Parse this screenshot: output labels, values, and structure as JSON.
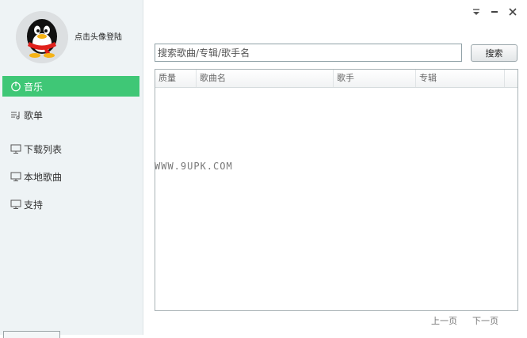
{
  "user": {
    "login_prompt": "点击头像登陆"
  },
  "sidebar": {
    "items": [
      {
        "label": "音乐",
        "icon": "power-icon",
        "active": true
      },
      {
        "label": "歌单",
        "icon": "playlist-icon",
        "active": false
      },
      {
        "label": "下载列表",
        "icon": "monitor-icon",
        "active": false
      },
      {
        "label": "本地歌曲",
        "icon": "monitor-icon",
        "active": false
      },
      {
        "label": "支持",
        "icon": "monitor-icon",
        "active": false
      }
    ]
  },
  "window_controls": {
    "menu": "▼",
    "minimize": "−",
    "close": "✕"
  },
  "search": {
    "placeholder": "搜索歌曲/专辑/歌手名",
    "button_label": "搜索"
  },
  "table": {
    "columns": [
      "质量",
      "歌曲名",
      "歌手",
      "专辑"
    ],
    "rows": []
  },
  "watermark": "WWW.9UPK.COM",
  "pager": {
    "prev": "上一页",
    "next": "下一页"
  },
  "colors": {
    "accent": "#3fc776",
    "sidebar_bg": "#eef3f5"
  }
}
